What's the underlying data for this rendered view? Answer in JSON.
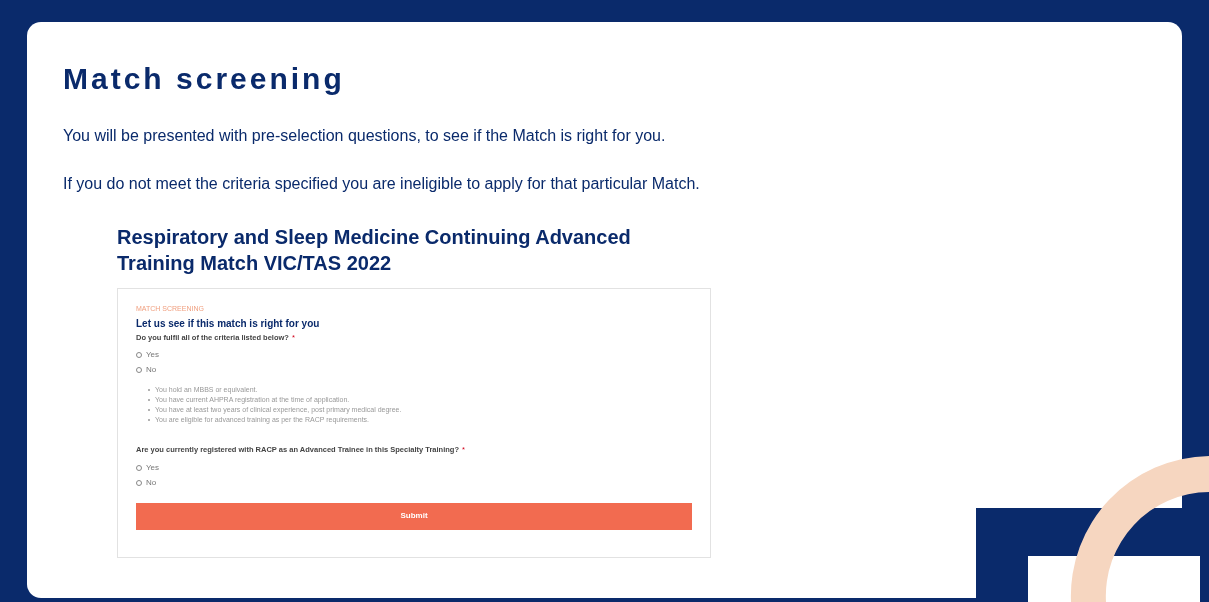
{
  "title": "Match screening",
  "paragraphs": [
    "You will be presented with pre-selection questions, to see if the Match is right for you.",
    "If you do not meet the criteria specified you are ineligible to apply for that particular Match."
  ],
  "match_title": "Respiratory and Sleep Medicine Continuing Advanced Training Match VIC/TAS 2022",
  "form": {
    "eyebrow": "MATCH SCREENING",
    "heading": "Let us see if this match is right for you",
    "questions": [
      {
        "label": "Do you fulfil all of the criteria listed below?",
        "required_mark": "*",
        "options": [
          {
            "label": "Yes",
            "selected": false
          },
          {
            "label": "No",
            "selected": false
          }
        ],
        "criteria": [
          "You hold an MBBS or equivalent.",
          "You have current AHPRA registration at the time of application.",
          "You have at least two years of clinical experience, post primary medical degree.",
          "You are eligible for advanced training as per the RACP requirements."
        ]
      },
      {
        "label": "Are you currently registered with RACP as an Advanced Trainee in this Specialty Training?",
        "required_mark": "*",
        "options": [
          {
            "label": "Yes",
            "selected": false
          },
          {
            "label": "No",
            "selected": false
          }
        ]
      }
    ],
    "submit": "Submit"
  }
}
